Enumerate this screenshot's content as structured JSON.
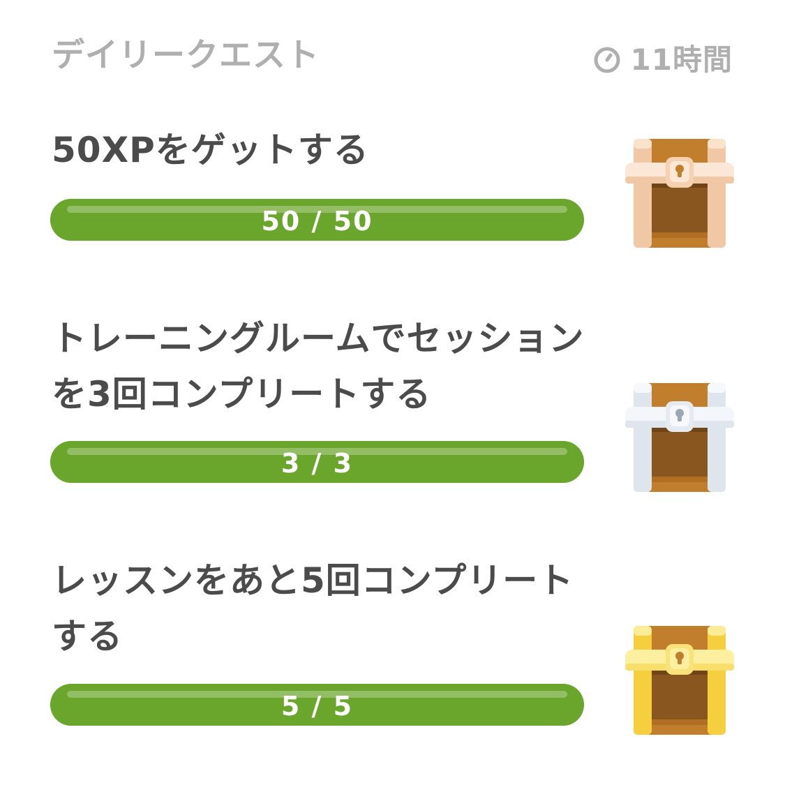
{
  "header": {
    "title": "デイリークエスト",
    "timer_icon": "timer-icon",
    "timer_text": "11時間"
  },
  "quests": [
    {
      "title": "50XPをゲットする",
      "progress_label": "50 / 50",
      "progress": 1.0,
      "chest": "bronze-chest-icon",
      "chest_frame_color": "#f1c8a6"
    },
    {
      "title": "トレーニングルームでセッションを3回コンプリートする",
      "progress_label": "3 / 3",
      "progress": 1.0,
      "chest": "silver-chest-icon",
      "chest_frame_color": "#dfe5ec"
    },
    {
      "title": "レッスンをあと5回コンプリートする",
      "progress_label": "5 / 5",
      "progress": 1.0,
      "chest": "gold-chest-icon",
      "chest_frame_color": "#f8df6c"
    }
  ],
  "colors": {
    "progress_green": "#6aa52c",
    "header_gray": "#afafaf",
    "title_dark": "#4b4b4b"
  }
}
